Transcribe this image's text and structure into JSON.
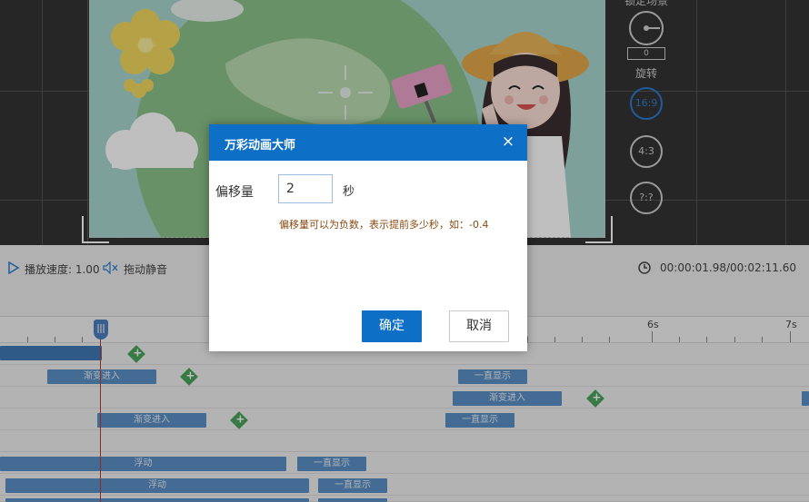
{
  "side_tools": {
    "lock_label": "锁定场景",
    "rotate_value": "0",
    "rotate_label": "旋转",
    "ratio_169": "16:9",
    "ratio_43": "4:3",
    "ratio_custom": "?:?"
  },
  "play_bar": {
    "speed_label": "播放速度: 1.00",
    "mute_label": "拖动静音",
    "time": "00:00:01.98/00:02:11.60"
  },
  "ruler": {
    "labels": [
      "6s",
      "7s"
    ]
  },
  "tracks": {
    "clip_fade_in": "渐变进入",
    "clip_always_show": "一直显示",
    "clip_float": "浮动"
  },
  "dialog": {
    "title": "万彩动画大师",
    "close": "×",
    "field_label": "偏移量",
    "field_value": "2",
    "unit": "秒",
    "hint": "偏移量可以为负数，表示提前多少秒，如：-0.4",
    "ok": "确定",
    "cancel": "取消"
  },
  "colors": {
    "accent": "#0d6fc6",
    "hint": "#8a4a12",
    "clip": "#5b8fc4",
    "keyframe": "#4aa35b",
    "playhead": "#c0392b"
  }
}
